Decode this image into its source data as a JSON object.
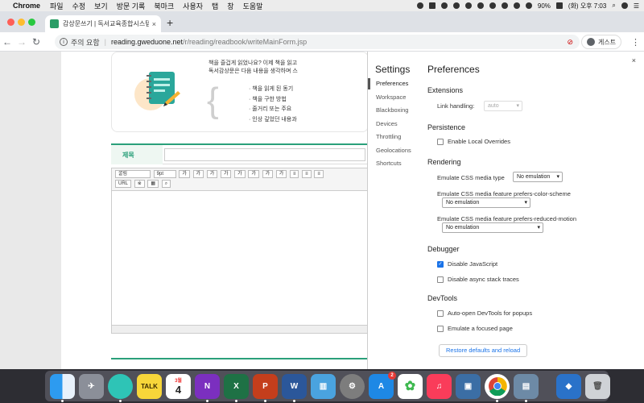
{
  "menubar": {
    "app": "Chrome",
    "items": [
      "파일",
      "수정",
      "보기",
      "방문 기록",
      "북마크",
      "사용자",
      "탭",
      "창",
      "도움말"
    ],
    "battery": "90%",
    "clock": "(화) 오후 7:03"
  },
  "browser": {
    "tab_title": "감상문쓰기 | 독서교육종합시스템입니",
    "security": "주의 요함",
    "url_host": "reading.gweduone.net",
    "url_path": "/r/reading/readbook/writeMainForm.jsp",
    "profile": "게스트"
  },
  "page": {
    "guide_line1": "책을 즐겁게 읽었나요? 이제 책을 읽고",
    "guide_line2": "독서감상문은 다음 내용을 생각하며 스",
    "guide_items": [
      "책을 읽게 된 동기",
      "책을 구한 방법",
      "줄거리 또는 주요 ",
      "인상 깊었던 내용과"
    ],
    "title_label": "제목",
    "editor_font": "굴림",
    "editor_size": "9pt"
  },
  "devtools": {
    "settings_title": "Settings",
    "nav": [
      "Preferences",
      "Workspace",
      "Blackboxing",
      "Devices",
      "Throttling",
      "Geolocations",
      "Shortcuts"
    ],
    "pane_title": "Preferences",
    "extensions": {
      "heading": "Extensions",
      "link_label": "Link handling:",
      "link_value": "auto"
    },
    "persistence": {
      "heading": "Persistence",
      "local_overrides": "Enable Local Overrides"
    },
    "rendering": {
      "heading": "Rendering",
      "media_type_label": "Emulate CSS media type",
      "media_type_value": "No emulation",
      "color_scheme_label": "Emulate CSS media feature prefers-color-scheme",
      "color_scheme_value": "No emulation",
      "reduced_motion_label": "Emulate CSS media feature prefers-reduced-motion",
      "reduced_motion_value": "No emulation"
    },
    "debugger": {
      "heading": "Debugger",
      "disable_js": "Disable JavaScript",
      "disable_js_checked": true,
      "disable_async": "Disable async stack traces"
    },
    "devtools_sec": {
      "heading": "DevTools",
      "auto_open": "Auto-open DevTools for popups",
      "emulate_focus": "Emulate a focused page"
    },
    "restore": "Restore defaults and reload",
    "close": "×"
  },
  "dock": {
    "calendar_month": "3월",
    "calendar_day": "4",
    "appstore_badge": "2",
    "talk": "TALK"
  }
}
